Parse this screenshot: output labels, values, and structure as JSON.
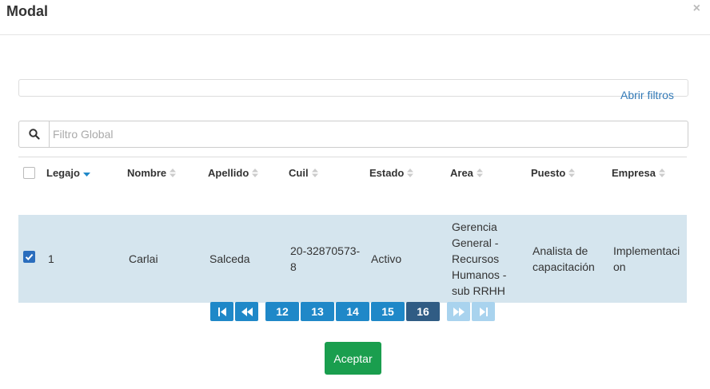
{
  "modal": {
    "title": "Modal",
    "close_glyph": "×"
  },
  "filters": {
    "open_label": "Abrir filtros"
  },
  "search": {
    "placeholder": "Filtro Global",
    "icon": "search-icon"
  },
  "table": {
    "columns": [
      "Legajo",
      "Nombre",
      "Apellido",
      "Cuil",
      "Estado",
      "Area",
      "Puesto",
      "Empresa"
    ],
    "sorted_column": "Legajo",
    "rows": [
      {
        "checked": true,
        "legajo": "1",
        "nombre": "Carlai",
        "apellido": "Salceda",
        "cuil_line1": "20-32870573-",
        "cuil_line2": "8",
        "estado": "Activo",
        "area_lines": [
          "Gerencia",
          "General -",
          "Recursos",
          "Humanos -",
          "sub RRHH"
        ],
        "puesto_lines": [
          "Analista de",
          "capacitación"
        ],
        "empresa_lines": [
          "Implementaci",
          "on"
        ]
      }
    ]
  },
  "pagination": {
    "pages": [
      "12",
      "13",
      "14",
      "15",
      "16"
    ],
    "current": "16",
    "accent": "#1f88c8",
    "active_color": "#305c84"
  },
  "footer": {
    "accept_label": "Aceptar",
    "accept_color": "#1a9e4e"
  }
}
